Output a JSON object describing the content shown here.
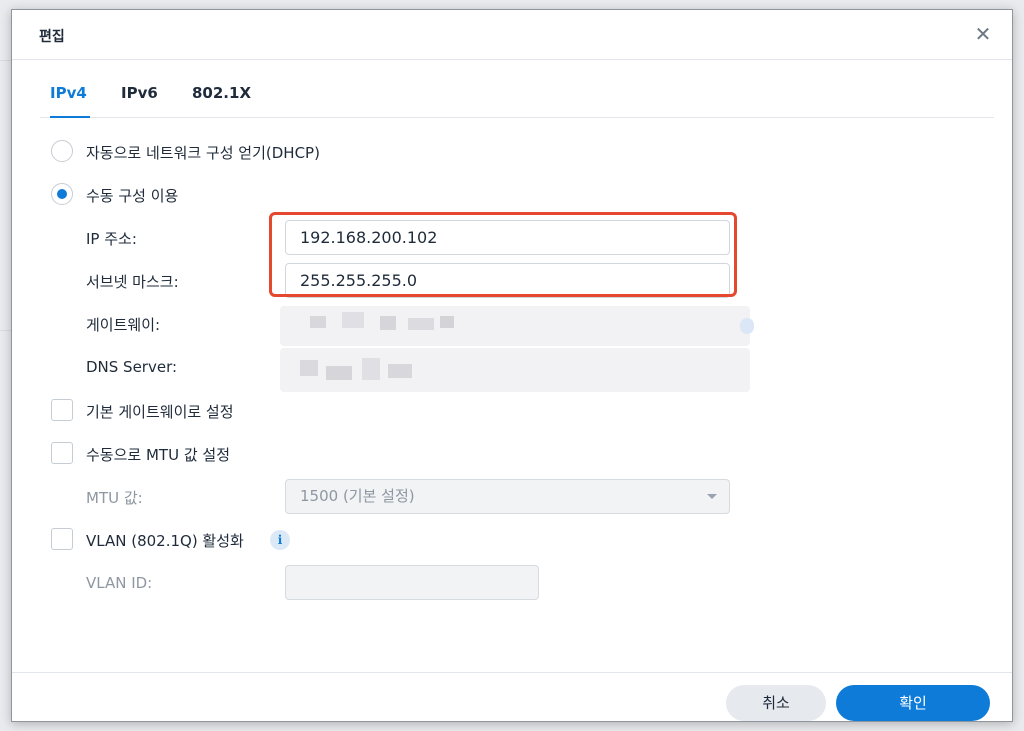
{
  "dialog": {
    "title": "편집",
    "close_glyph": "✕"
  },
  "tabs": [
    {
      "label": "IPv4",
      "active": true
    },
    {
      "label": "IPv6",
      "active": false
    },
    {
      "label": "802.1X",
      "active": false
    }
  ],
  "options": {
    "dhcp_label": "자동으로 네트워크 구성 얻기(DHCP)",
    "manual_label": "수동 구성 이용",
    "selected": "manual"
  },
  "fields": {
    "ip_label": "IP 주소:",
    "ip_value": "192.168.200.102",
    "subnet_label": "서브넷 마스크:",
    "subnet_value": "255.255.255.0",
    "gateway_label": "게이트웨이:",
    "dns_label": "DNS Server:"
  },
  "checkboxes": {
    "default_gateway_label": "기본 게이트웨이로 설정",
    "manual_mtu_label": "수동으로 MTU 값 설정",
    "vlan_label": "VLAN (802.1Q) 활성화"
  },
  "mtu": {
    "label": "MTU 값:",
    "selected_value": "1500 (기본 설정)"
  },
  "vlan": {
    "id_label": "VLAN ID:",
    "info_glyph": "i"
  },
  "footer": {
    "cancel_label": "취소",
    "ok_label": "확인"
  },
  "colors": {
    "accent": "#0e7bd8",
    "highlight": "#e5472f"
  },
  "icons": {
    "close": "close-icon",
    "info": "info-icon",
    "dropdown": "chevron-down-icon"
  }
}
